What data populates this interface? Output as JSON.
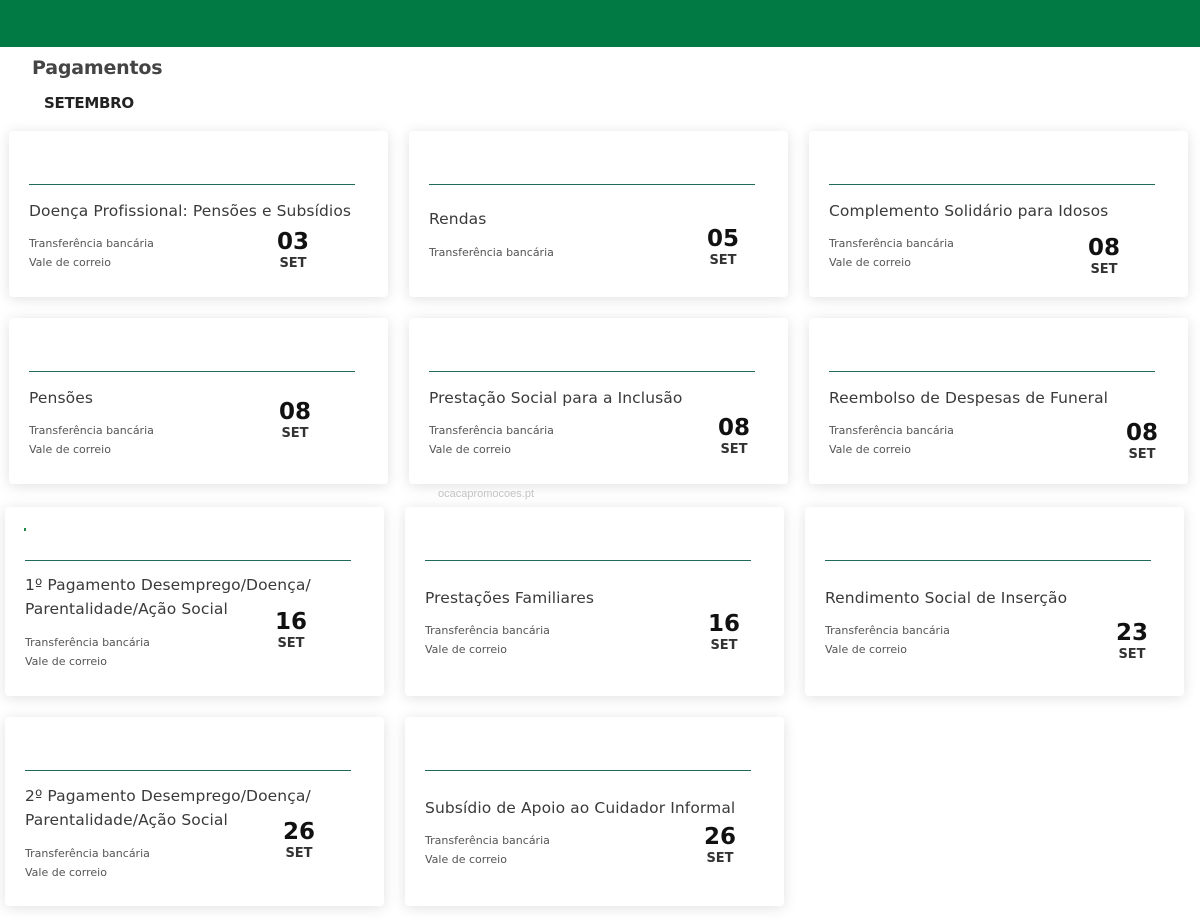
{
  "header": {
    "title": "Pagamentos",
    "month": "SETEMBRO",
    "brand_color": "#017a44"
  },
  "watermark": "ocacapromocoes.pt",
  "cards": [
    {
      "title": "Doença Profissional: Pensões e Subsídios",
      "methods": [
        "Transferência bancária",
        "Vale de correio"
      ],
      "day": "03",
      "month": "SET"
    },
    {
      "title": "Rendas",
      "methods": [
        "Transferência bancária"
      ],
      "day": "05",
      "month": "SET"
    },
    {
      "title": "Complemento Solidário para Idosos",
      "methods": [
        "Transferência bancária",
        "Vale de correio"
      ],
      "day": "08",
      "month": "SET"
    },
    {
      "title": "Pensões",
      "methods": [
        "Transferência bancária",
        "Vale de correio"
      ],
      "day": "08",
      "month": "SET"
    },
    {
      "title": "Prestação Social para a Inclusão",
      "methods": [
        "Transferência bancária",
        "Vale de correio"
      ],
      "day": "08",
      "month": "SET"
    },
    {
      "title": "Reembolso de Despesas de Funeral",
      "methods": [
        "Transferência bancária",
        "Vale de correio"
      ],
      "day": "08",
      "month": "SET"
    },
    {
      "title_lines": [
        "1º Pagamento Desemprego/Doença/",
        "Parentalidade/Ação Social"
      ],
      "methods": [
        "Transferência bancária",
        "Vale de correio"
      ],
      "day": "16",
      "month": "SET"
    },
    {
      "title": "Prestações Familiares",
      "methods": [
        "Transferência bancária",
        "Vale de correio"
      ],
      "day": "16",
      "month": "SET"
    },
    {
      "title": "Rendimento Social de Inserção",
      "methods": [
        "Transferência bancária",
        "Vale de correio"
      ],
      "day": "23",
      "month": "SET"
    },
    {
      "title_lines": [
        "2º Pagamento Desemprego/Doença/",
        "Parentalidade/Ação Social"
      ],
      "methods": [
        "Transferência bancária",
        "Vale de correio"
      ],
      "day": "26",
      "month": "SET"
    },
    {
      "title": "Subsídio de Apoio ao Cuidador Informal",
      "methods": [
        "Transferência bancária",
        "Vale de correio"
      ],
      "day": "26",
      "month": "SET"
    }
  ]
}
